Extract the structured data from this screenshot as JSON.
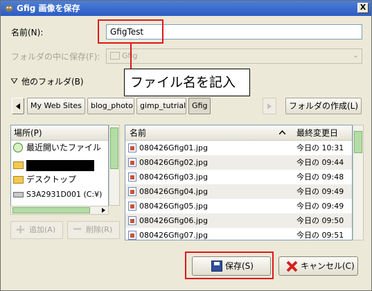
{
  "window": {
    "title": "Gfig 画像を保存",
    "close_symbol": "X"
  },
  "name_field": {
    "label": "名前(N):",
    "value": "GfigTest"
  },
  "save_in_folder": {
    "label": "フォルダの中に保存(F):",
    "value": "Gfig"
  },
  "other_folders": {
    "label": "他のフォルダ(B)"
  },
  "annotation": {
    "text": "ファイル名を記入"
  },
  "breadcrumbs": [
    "My Web Sites",
    "blog_photo",
    "gimp_tutrial",
    "Gfig"
  ],
  "create_folder_button": "フォルダの作成(L)",
  "places": {
    "header": "場所(P)",
    "items": [
      {
        "label": "最近開いたファイル",
        "icon": "recent-icon"
      },
      {
        "label": "",
        "icon": "folder-icon",
        "redacted": true
      },
      {
        "label": "デスクトップ",
        "icon": "folder-icon"
      },
      {
        "label": "S3A2931D001 (C:¥)",
        "icon": "drive-icon"
      }
    ],
    "add_button": "追加(A)",
    "remove_button": "削除(R)"
  },
  "files": {
    "col_name": "名前",
    "col_modified": "最終変更日",
    "rows": [
      {
        "name": "080426Gfig01.jpg",
        "modified": "今日の 10:31"
      },
      {
        "name": "080426Gfig02.jpg",
        "modified": "今日の 09:44"
      },
      {
        "name": "080426Gfig03.jpg",
        "modified": "今日の 09:48"
      },
      {
        "name": "080426Gfig04.jpg",
        "modified": "今日の 09:49"
      },
      {
        "name": "080426Gfig05.jpg",
        "modified": "今日の 09:49"
      },
      {
        "name": "080426Gfig06.jpg",
        "modified": "今日の 09:50"
      },
      {
        "name": "080426Gfig07.jpg",
        "modified": "今日の 09:51"
      }
    ]
  },
  "save_button": "保存(S)",
  "cancel_button": "キャンセル(C)",
  "colors": {
    "highlight_box": "#e0151a",
    "titlebar": "#2b5cc4",
    "dialog_bg": "#ece9d8"
  }
}
